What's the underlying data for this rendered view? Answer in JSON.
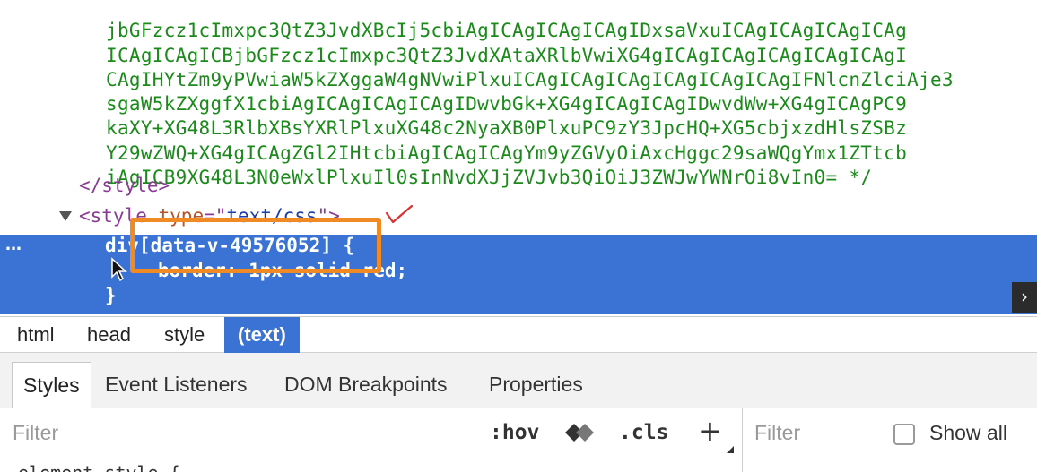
{
  "code": {
    "base64_lines": [
      "jbGFzcz1cImxpc3QtZ3JvdXBcIj5cbiAgICAgICAgICAgIDxsaVxuICAgICAgICAgICAg",
      "ICAgICAgICBjbGFzcz1cImxpc3QtZ3JvdXAtaXRlbVwiXG4gICAgICAgICAgICAgICAgI",
      "CAgIHYtZm9yPVwiaW5kZXggaW4gNVwiPlxuICAgICAgICAgICAgICAgICAgIFNlcnZlciAje3",
      "sgaW5kZXggfX1cbiAgICAgICAgICAgIDwvbGk+XG4gICAgICAgIDwvdWw+XG4gICAgPC9",
      "kaXY+XG48L3RlbXBsYXRlPlxuXG48c2NyaXB0PlxuPC9zY3JpcHQ+XG5cbjxzdHlsZSBz",
      "Y29wZWQ+XG4gICAgZGl2IHtcbiAgICAgICAgYm9yZGVyOiAxcHggc29saWQgYmx1ZTtcb",
      "iAgICB9XG48L3N0eWxlPlxuIl0sInNvdXJjZVJvb3QiOiJ3ZWJwYWNrOi8vIn0= */"
    ],
    "close_style": "</style>",
    "style_tag_prefix": "<style ",
    "style_attr_name": "type",
    "style_attr_eq": "=\"",
    "style_attr_value": "text/css",
    "style_attr_close": "\">",
    "selected_selector": "div[data-v-49576052] {",
    "selected_decl": "border: 1px solid red;",
    "selected_close": "}",
    "row_dots": "…",
    "expand_chevron": "›"
  },
  "breadcrumb": [
    "html",
    "head",
    "style",
    "(text)"
  ],
  "tabs": [
    "Styles",
    "Event Listeners",
    "DOM Breakpoints",
    "Properties"
  ],
  "filter": {
    "placeholder": "Filter",
    "hov_label": ":hov",
    "cls_label": ".cls",
    "add_label": "+",
    "right_placeholder": "Filter",
    "show_all_label": "Show all"
  },
  "bottom_partial": "element.style {",
  "colors": {
    "base64_green": "#1b8a1b",
    "tag_purple": "#8b3b96",
    "selection_blue": "#3a73d4",
    "annotation_orange": "#f08a24",
    "annotation_red": "#e03030"
  }
}
